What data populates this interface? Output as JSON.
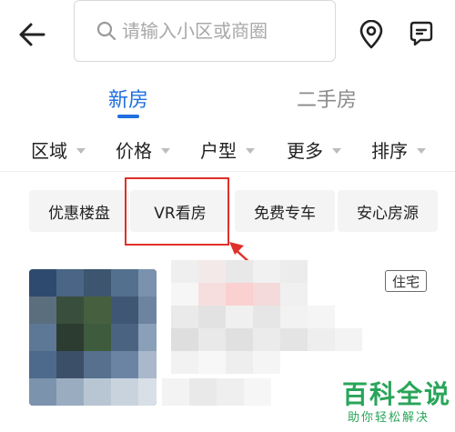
{
  "search": {
    "placeholder": "请输入小区或商圈"
  },
  "tabs": [
    {
      "label": "新房",
      "active": true
    },
    {
      "label": "二手房",
      "active": false
    }
  ],
  "filters": [
    {
      "label": "区域"
    },
    {
      "label": "价格"
    },
    {
      "label": "户型"
    },
    {
      "label": "更多"
    },
    {
      "label": "排序"
    }
  ],
  "chips": [
    {
      "label": "优惠楼盘"
    },
    {
      "label": "VR看房"
    },
    {
      "label": "免费专车"
    },
    {
      "label": "安心房源"
    }
  ],
  "listing": {
    "type_badge": "住宅"
  },
  "watermark": {
    "title": "百科全说",
    "subtitle": "助你轻松解决"
  },
  "colors": {
    "accent": "#1f6fe0",
    "annotation": "#e0302a",
    "watermark": "#29a55a"
  },
  "icons": [
    "back-arrow-icon",
    "search-icon",
    "location-pin-icon",
    "message-icon",
    "chevron-down-icon"
  ]
}
